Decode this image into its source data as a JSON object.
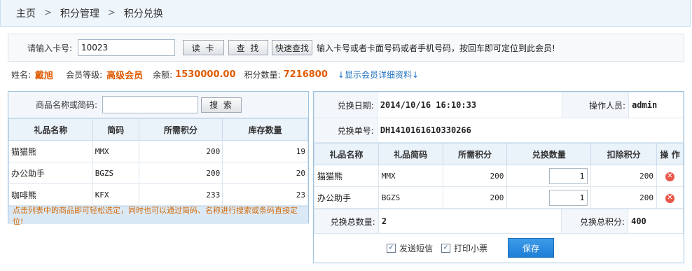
{
  "breadcrumb": [
    "主页",
    "积分管理",
    "积分兑换"
  ],
  "card": {
    "label": "请输入卡号:",
    "value": "10023",
    "read_btn": "读 卡",
    "find_btn": "查 找",
    "quick_btn": "快速查找",
    "hint": "输入卡号或者卡面号码或者手机号码，按回车即可定位到此会员!"
  },
  "member": {
    "name_label": "姓名:",
    "name": "戴旭",
    "level_label": "会员等级:",
    "level": "高级会员",
    "balance_label": "余额:",
    "balance": "1530000.00",
    "points_label": "积分数量:",
    "points": "7216800",
    "detail_link": "↓显示会员详细资料↓"
  },
  "gift_search": {
    "label": "商品名称或简码:",
    "placeholder": "",
    "button": "搜 索"
  },
  "gift_table": {
    "headers": [
      "礼品名称",
      "简码",
      "所需积分",
      "库存数量"
    ],
    "rows": [
      {
        "name": "猫猫熊",
        "code": "MMX",
        "points": "200",
        "stock": "19"
      },
      {
        "name": "办公助手",
        "code": "BGZS",
        "points": "200",
        "stock": "20"
      },
      {
        "name": "咖啡熊",
        "code": "KFX",
        "points": "233",
        "stock": "23"
      }
    ],
    "tip": "点击列表中的商品即可轻松选定，同时也可以通过简码、名称进行搜索或条码直接定位!"
  },
  "exchange": {
    "date_label": "兑换日期:",
    "date": "2014/10/16 16:10:33",
    "operator_label": "操作人员:",
    "operator": "admin",
    "order_label": "兑换单号:",
    "order": "DH1410161610330266",
    "headers": [
      "礼品名称",
      "礼品简码",
      "所需积分",
      "兑换数量",
      "扣除积分",
      "操 作"
    ],
    "rows": [
      {
        "name": "猫猫熊",
        "code": "MMX",
        "points": "200",
        "qty": "1",
        "deduct": "200"
      },
      {
        "name": "办公助手",
        "code": "BGZS",
        "points": "200",
        "qty": "1",
        "deduct": "200"
      }
    ],
    "total_qty_label": "兑换总数量:",
    "total_qty": "2",
    "total_points_label": "兑换总积分:",
    "total_points": "400",
    "sms_label": "发送短信",
    "print_label": "打印小票",
    "save_label": "保存"
  }
}
